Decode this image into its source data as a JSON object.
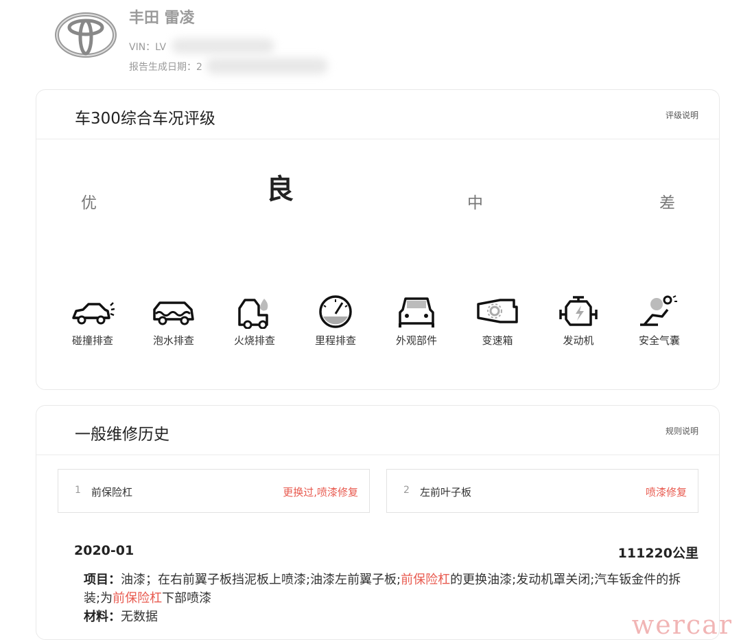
{
  "vehicle": {
    "brand_logo": "toyota-logo",
    "title": "丰田 雷凌",
    "vin_label": "VIN：LV",
    "report_date_label": "报告生成日期：2"
  },
  "rating_card": {
    "title": "车300综合车况评级",
    "link": "评级说明",
    "grades": [
      "优",
      "良",
      "中",
      "差"
    ],
    "active_grade": "良",
    "checks": [
      {
        "label": "碰撞排查",
        "icon": "collision-car-icon"
      },
      {
        "label": "泡水排查",
        "icon": "flood-car-icon"
      },
      {
        "label": "火烧排查",
        "icon": "fire-car-icon"
      },
      {
        "label": "里程排查",
        "icon": "odometer-icon"
      },
      {
        "label": "外观部件",
        "icon": "car-front-icon"
      },
      {
        "label": "变速箱",
        "icon": "gearbox-icon"
      },
      {
        "label": "发动机",
        "icon": "engine-icon"
      },
      {
        "label": "安全气囊",
        "icon": "airbag-icon"
      }
    ]
  },
  "repair_card": {
    "title": "一般维修历史",
    "link": "规则说明",
    "parts": [
      {
        "index": "1",
        "name": "前保险杠",
        "status": "更换过,喷漆修复"
      },
      {
        "index": "2",
        "name": "左前叶子板",
        "status": "喷漆修复"
      }
    ],
    "record": {
      "date": "2020-01",
      "mileage": "111220公里",
      "project_label": "项目：",
      "project_text_1": "油漆；在右前翼子板挡泥板上喷漆;油漆左前翼子板;",
      "project_hl_1": "前保险杠",
      "project_text_2": "的更换油漆;发动机罩关闭;汽车钣金件的拆装;为",
      "project_hl_2": "前保险杠",
      "project_text_3": "下部喷漆",
      "material_label": "材料：",
      "material_text": "无数据"
    }
  },
  "watermark": "wercar"
}
